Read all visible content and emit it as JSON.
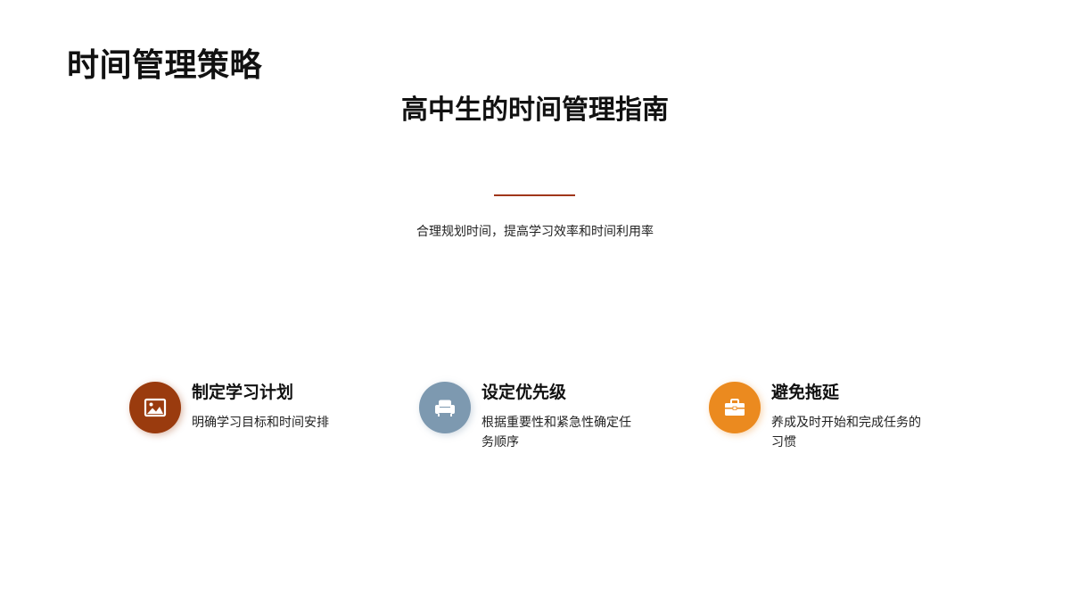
{
  "header": {
    "slide_title": "时间管理策略"
  },
  "hero": {
    "title": "高中生的时间管理指南",
    "subtitle": "合理规划时间，提高学习效率和时间利用率",
    "divider_color": "#a0361a"
  },
  "features": [
    {
      "title": "制定学习计划",
      "description": "明确学习目标和时间安排",
      "icon": "image-icon",
      "color": "#9a3b0e"
    },
    {
      "title": "设定优先级",
      "description": "根据重要性和紧急性确定任务顺序",
      "icon": "sofa-icon",
      "color": "#7d99b0"
    },
    {
      "title": "避免拖延",
      "description": "养成及时开始和完成任务的习惯",
      "icon": "briefcase-icon",
      "color": "#eb8a1f"
    }
  ]
}
